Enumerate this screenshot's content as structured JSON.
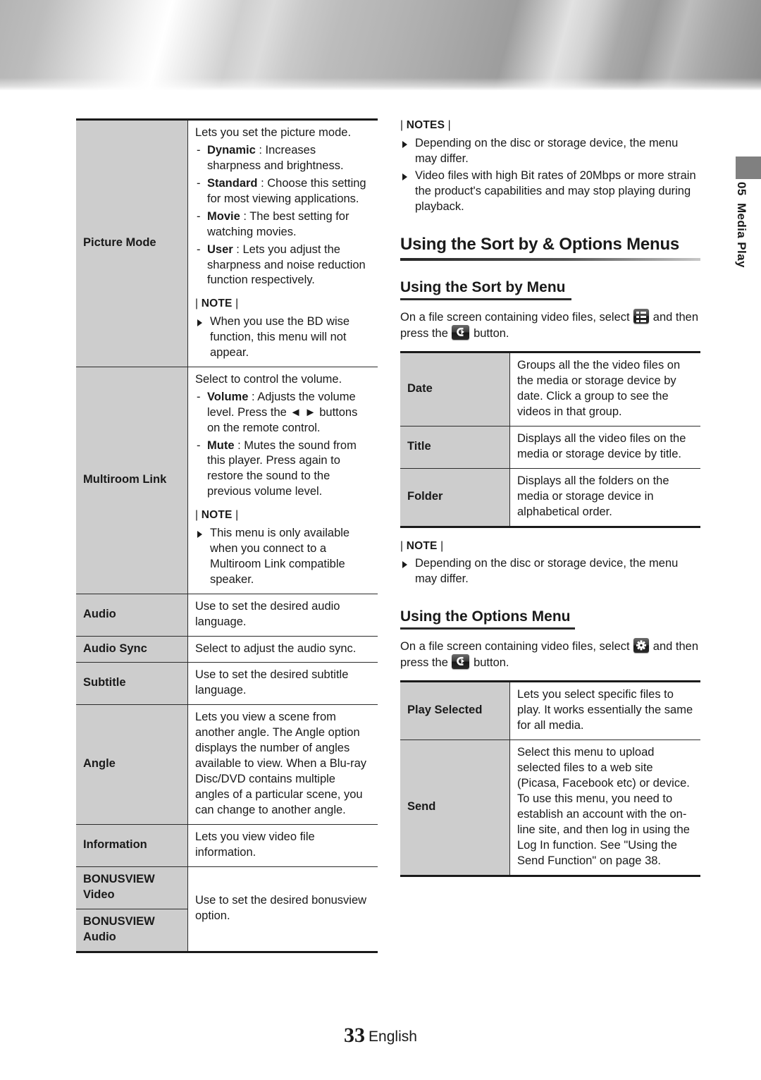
{
  "page": {
    "number": "33",
    "language": "English",
    "chapter_number": "05",
    "chapter_title": "Media Play"
  },
  "left_table": {
    "rows": [
      {
        "key": "Picture Mode",
        "lead": "Lets you set the picture mode.",
        "items": [
          {
            "term": "Dynamic",
            "text": " : Increases sharpness and brightness."
          },
          {
            "term": "Standard",
            "text": " : Choose this setting for most viewing applications."
          },
          {
            "term": "Movie",
            "text": " : The best setting for watching movies."
          },
          {
            "term": "User",
            "text": " : Lets you adjust the sharpness and noise reduction function respectively."
          }
        ],
        "note_head": "NOTE",
        "notes": [
          "When you use the BD wise function, this menu will not appear."
        ]
      },
      {
        "key": "Multiroom Link",
        "lead": "Select to control the volume.",
        "items": [
          {
            "term": "Volume",
            "text": " : Adjusts the volume level. Press the ◄ ► buttons on the remote control."
          },
          {
            "term": "Mute",
            "text": " : Mutes the sound from this player. Press again to restore the sound to the previous volume level."
          }
        ],
        "note_head": "NOTE",
        "notes": [
          "This menu is only available when you connect to a Multiroom Link compatible speaker."
        ]
      },
      {
        "key": "Audio",
        "lead": "Use to set the desired audio language."
      },
      {
        "key": "Audio Sync",
        "lead": "Select to adjust the audio sync."
      },
      {
        "key": "Subtitle",
        "lead": "Use to set the desired subtitle language."
      },
      {
        "key": "Angle",
        "lead": "Lets you view a scene from another angle. The Angle option displays the number of angles available to view. When a Blu-ray Disc/DVD contains multiple angles of a particular scene, you can change to another angle."
      },
      {
        "key": "Information",
        "lead": "Lets you view video file information."
      }
    ],
    "bonusview": {
      "key_video_line1": "BONUSVIEW",
      "key_video_line2": "Video",
      "key_audio_line1": "BONUSVIEW",
      "key_audio_line2": "Audio",
      "value": "Use to set the desired bonusview option."
    }
  },
  "right_column": {
    "notes_top": {
      "head": "NOTES",
      "items": [
        "Depending on the disc or storage device, the menu may differ.",
        "Video files with high Bit rates of 20Mbps or more strain the product's capabilities and may stop playing during playback."
      ]
    },
    "section_title": "Using the Sort by & Options Menus",
    "sort_by": {
      "heading": "Using the Sort by Menu",
      "intro_a": "On a file screen containing video files, select",
      "intro_b": "and then press the",
      "intro_c": "button.",
      "select_icon": "list-icon",
      "press_icon": "enter-button-icon",
      "rows": [
        {
          "key": "Date",
          "value": "Groups all the the video files on the media or storage device by date. Click a group to see the videos in that group."
        },
        {
          "key": "Title",
          "value": "Displays all the video files on the media or storage device by title."
        },
        {
          "key": "Folder",
          "value": "Displays all the folders on the media or storage device in alphabetical order."
        }
      ]
    },
    "notes_mid": {
      "head": "NOTE",
      "items": [
        "Depending on the disc or storage device, the menu may differ."
      ]
    },
    "options": {
      "heading": "Using the Options Menu",
      "intro_a": "On a file screen containing video files, select",
      "intro_b": "and then press the",
      "intro_c": "button.",
      "select_icon": "gear-icon",
      "press_icon": "enter-button-icon",
      "rows": [
        {
          "key": "Play Selected",
          "value": "Lets you select specific files to play. It works essentially the same for all media."
        },
        {
          "key": "Send",
          "value": "Select this menu to upload selected files to a web site (Picasa, Facebook etc) or device. To use this menu, you need to establish an account with the on-line site, and then log in using the Log In function. See \"Using the Send Function\" on page 38."
        }
      ]
    }
  }
}
